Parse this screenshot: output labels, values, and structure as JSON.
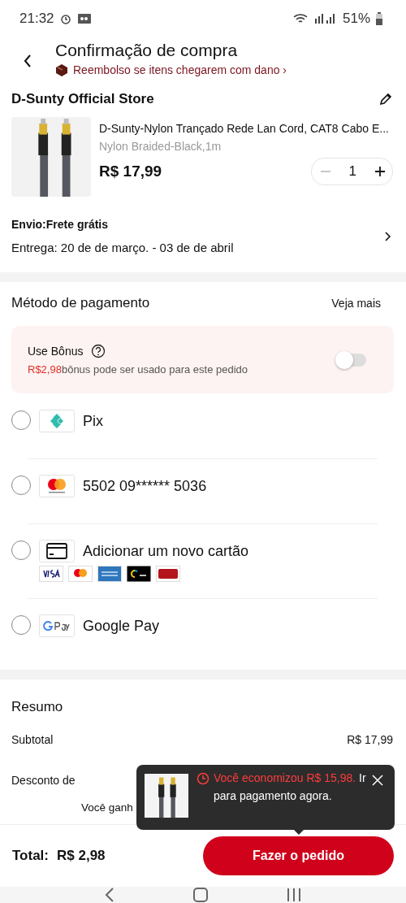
{
  "status_bar": {
    "time": "21:32",
    "battery": "51%"
  },
  "header": {
    "title": "Confirmação de compra",
    "notice": "Reembolso se itens chegarem com dano ›"
  },
  "store": {
    "name": "D-Sunty Official Store"
  },
  "product": {
    "kind": "picture",
    "title": "D-Sunty-Nylon Trançado Rede Lan Cord, CAT8 Cabo E...",
    "variant": "Nylon Braided-Black,1m",
    "price": "R$ 17,99",
    "quantity": "1"
  },
  "shipping": {
    "label": "Envio:Frete grátis",
    "delivery": "Entrega: 20 de de março. - 03 de de abril"
  },
  "payment": {
    "title": "Método de pagamento",
    "more": "Veja mais",
    "bonus": {
      "label": "Use Bônus",
      "text": "**R$2,98**bônus pode ser usado para este pedido",
      "on": false
    },
    "methods": [
      {
        "kind": "pix",
        "label": "Pix",
        "selected": false
      },
      {
        "kind": "mastercard",
        "label": "5502 09****** 5036",
        "selected": false
      },
      {
        "kind": "newcard",
        "label": "Adicionar um novo cartão",
        "selected": false
      },
      {
        "kind": "gpay",
        "label": "Google Pay",
        "selected": false
      }
    ]
  },
  "summary": {
    "title": "Resumo",
    "rows": [
      {
        "label": "Subtotal",
        "value": "R$ 17,99"
      },
      {
        "label": "Desconto de"
      }
    ],
    "credits": "Você ganh"
  },
  "footer": {
    "total_label": "Total:",
    "total": "R$ 2,98",
    "button": "Fazer o pedido"
  },
  "tooltip": {
    "highlight": "Você economizou R$ 15,98.",
    "text": " Ir para pagamento agora."
  }
}
